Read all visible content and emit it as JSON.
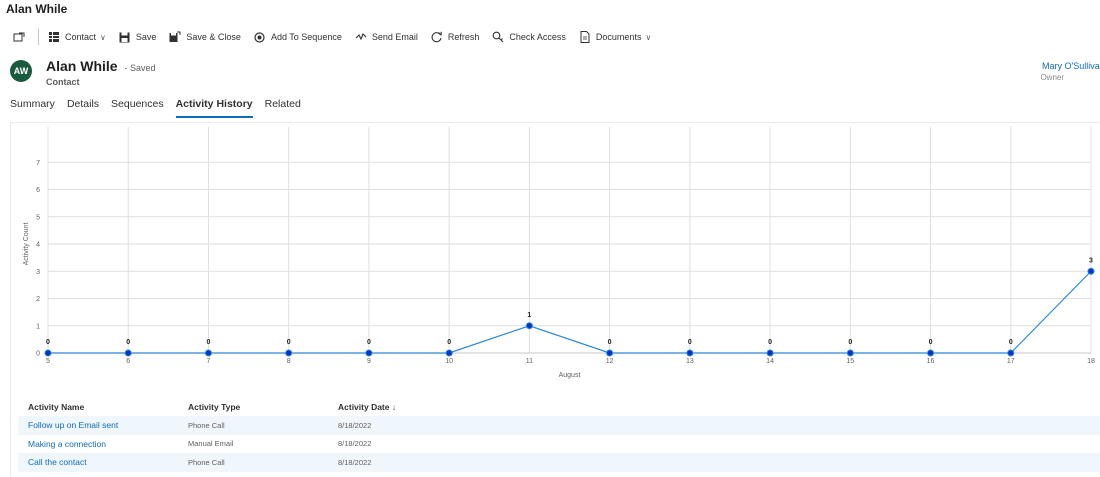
{
  "window": {
    "title": "Alan While"
  },
  "toolbar": {
    "items": [
      {
        "label": "Contact",
        "icon": "grid-icon"
      },
      {
        "label": "Save",
        "icon": "save-icon"
      },
      {
        "label": "Save & Close",
        "icon": "save-close-icon"
      },
      {
        "label": "Add To Sequence",
        "icon": "add-sequence-icon"
      },
      {
        "label": "Send Email",
        "icon": "send-email-icon"
      },
      {
        "label": "Refresh",
        "icon": "refresh-icon"
      },
      {
        "label": "Check Access",
        "icon": "check-access-icon"
      },
      {
        "label": "Documents",
        "icon": "documents-icon"
      }
    ]
  },
  "record": {
    "avatar_initials": "AW",
    "name": "Alan While",
    "status": "- Saved",
    "type": "Contact",
    "owner_name": "Mary O'Sullivan",
    "owner_label": "Owner"
  },
  "tabs": [
    "Summary",
    "Details",
    "Sequences",
    "Activity History",
    "Related"
  ],
  "active_tab": "Activity History",
  "chart_data": {
    "type": "line",
    "x": [
      5,
      6,
      7,
      8,
      9,
      10,
      11,
      12,
      13,
      14,
      15,
      16,
      17,
      18
    ],
    "series": [
      {
        "values": [
          0,
          0,
          0,
          0,
          0,
          0,
          1,
          0,
          0,
          0,
          0,
          0,
          0,
          3
        ]
      }
    ],
    "xlabel": "August",
    "ylabel": "Activity Count",
    "ylim": [
      0,
      8
    ],
    "yticks": [
      0,
      1,
      2,
      3,
      4,
      5,
      6,
      7
    ],
    "grid": true,
    "data_labels": true,
    "color": "#2b88d8"
  },
  "table": {
    "headers": [
      "Activity Name",
      "Activity Type",
      "Activity Date ↓"
    ],
    "rows": [
      [
        "Follow up on Email sent",
        "Phone Call",
        "8/18/2022"
      ],
      [
        "Making a connection",
        "Manual Email",
        "8/18/2022"
      ],
      [
        "Call the contact",
        "Phone Call",
        "8/18/2022"
      ]
    ]
  }
}
